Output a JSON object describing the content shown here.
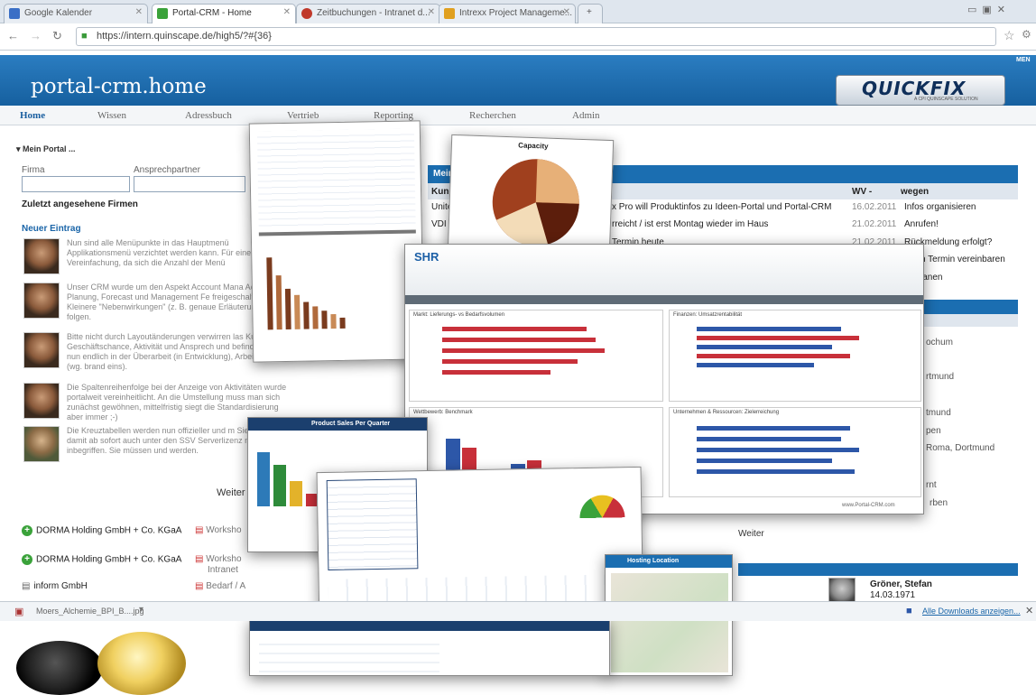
{
  "browser": {
    "tabs": [
      {
        "label": "Google Kalender",
        "color": "#3b6fc6"
      },
      {
        "label": "Portal-CRM - Home",
        "color": "#3aa23a"
      },
      {
        "label": "Zeitbuchungen - Intranet d...",
        "color": "#c0392b"
      },
      {
        "label": "Intrexx Project Manageme...",
        "color": "#e0a020"
      }
    ],
    "url": "https://intern.quinscape.de/high5/?#{36}",
    "menu_label": "MEN"
  },
  "app": {
    "title": "portal-crm.home",
    "logo_text": "QUICKFIX",
    "logo_subtext": "A CPI QUINSCAPE SOLUTION"
  },
  "nav": {
    "items": [
      "Home",
      "Wissen",
      "Adressbuch",
      "Vertrieb",
      "Reporting",
      "Recherchen",
      "Admin"
    ]
  },
  "left": {
    "portal_label": "Mein Portal ...",
    "firma_label": "Firma",
    "ansprech_label": "Ansprechpartner",
    "recent_heading": "Zuletzt angesehene Firmen",
    "new_entry": "Neuer Eintrag",
    "news": [
      "Nun sind alle Menüpunkte in das Hauptmenü Applikationsmenü verzichtet werden kann. Für eine Vereinfachung, da sich die Anzahl der Menü",
      "Unser CRM wurde um den Aspekt Account Mana Account Planung, Forecast und Management Fe freigeschaltet. Kleinere \"Nebenwirkungen\" (z. B. genaue Erläuterungen folgen.",
      "Bitte nicht durch Layoutänderungen verwirren las Kunde, Geschäftschance, Aktivität und Ansprech und befinden sich nun endlich in der Überarbeit (in Entwicklung), Arbeitstitel b1 (wg. brand eins).",
      "Die Spaltenreihenfolge bei der Anzeige von Aktivitäten wurde portalweit vereinheitlicht. An die Umstellung muss man sich zunächst gewöhnen, mittelfristig siegt die Standardisierung aber immer ;-)",
      "Die Kreuztabellen werden nun offizieller und m Sie Fallen damit ab sofort auch unter den SSV Serverlizenz mit inbegriffen. Sie müssen und werden."
    ],
    "weiter": "Weiter",
    "companies": [
      {
        "name": "DORMA Holding GmbH + Co. KGaA",
        "doc": "Worksho"
      },
      {
        "name": "DORMA Holding GmbH + Co. KGaA",
        "doc": "Worksho",
        "doc2": "Intranet"
      },
      {
        "name": "inform GmbH",
        "doc": "Bedarf / A"
      }
    ]
  },
  "right": {
    "panel_title": "Mein",
    "col_kunde": "Kund",
    "col_wv": "WV -",
    "col_wegen": "wegen",
    "rows": [
      {
        "prefix": "Unite",
        "text": "x Pro will Produktinfos zu Ideen-Portal und Portal-CRM",
        "date": "16.02.2011",
        "wegen": "Infos organisieren"
      },
      {
        "prefix": "VDI V",
        "text": "rreicht / ist erst Montag wieder im Haus",
        "date": "21.02.2011",
        "wegen": "Anrufen!"
      },
      {
        "prefix": "",
        "text": "Termin heute",
        "date": "21.02.2011",
        "wegen": "Rückmeldung erfolgt?"
      },
      {
        "prefix": "",
        "text": "",
        "date": "",
        "wegen": "n Termin vereinbaren"
      },
      {
        "prefix": "",
        "text": "",
        "date": "",
        "wegen": "lanen"
      }
    ],
    "side_cities": [
      "ochum",
      "rtmund",
      "tmund",
      "pen",
      "Roma, Dortmund",
      "rnt",
      "rben"
    ],
    "weiter2": "Weiter",
    "person_name": "Gröner, Stefan",
    "person_date": "14.03.1971"
  },
  "overlays": {
    "capacity_title": "Capacity",
    "product_sales_title": "Product Sales Per Quarter",
    "dashboard_brand": "SHR",
    "dashboard_footer": "www.Portal-CRM.com",
    "chart_titles": [
      "Markt: Lieferungs- vs Bedarfsvolumen",
      "Finanzen: Umsatzrentabilität",
      "Wettbewerb: Benchmark",
      "Unternehmen & Ressourcen: Zielerreichung"
    ],
    "hosting_title": "Hosting Location"
  },
  "downloads": {
    "file": "Moers_Alchemie_BPI_B....jpg",
    "show_all": "Alle Downloads anzeigen..."
  }
}
